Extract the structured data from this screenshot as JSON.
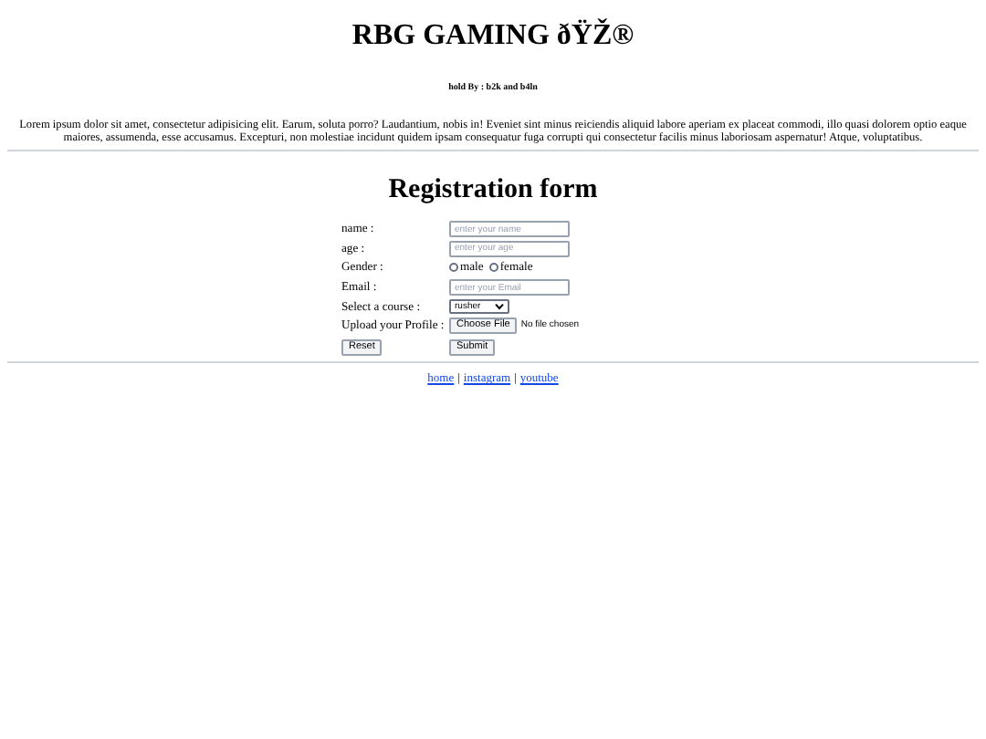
{
  "header": {
    "title": "RBG GAMING ðŸŽ®",
    "subtitle": "hold By : b2k and b4ln",
    "intro": "Lorem ipsum dolor sit amet, consectetur adipisicing elit. Earum, soluta porro? Laudantium, nobis in! Eveniet sint minus reiciendis aliquid labore aperiam ex placeat commodi, illo quasi dolorem optio eaque maiores, assumenda, esse accusamus. Excepturi, non molestiae incidunt quidem ipsam consequatur fuga corrupti qui consectetur facilis minus laboriosam aspernatur! Atque, voluptatibus."
  },
  "form": {
    "title": "Registration form",
    "rows": [
      {
        "kind": "text",
        "label": "name :",
        "placeholder": "enter your name"
      },
      {
        "kind": "text",
        "label": "age :",
        "placeholder": "enter your age"
      },
      {
        "kind": "radio",
        "label": "Gender :",
        "options": [
          {
            "label": "male",
            "selected": false
          },
          {
            "label": "female",
            "selected": false
          }
        ]
      },
      {
        "kind": "text",
        "label": "Email :",
        "placeholder": "enter your Email"
      },
      {
        "kind": "select",
        "label": "Select a course :",
        "value": "rusher"
      },
      {
        "kind": "file",
        "label": "Upload your Profile :",
        "button": "Choose File",
        "status": "No file chosen"
      },
      {
        "kind": "buttons",
        "reset": "Reset",
        "submit": "Submit"
      }
    ]
  },
  "footer": {
    "links": [
      "home",
      "instagram",
      "youtube"
    ],
    "separator": "|"
  }
}
